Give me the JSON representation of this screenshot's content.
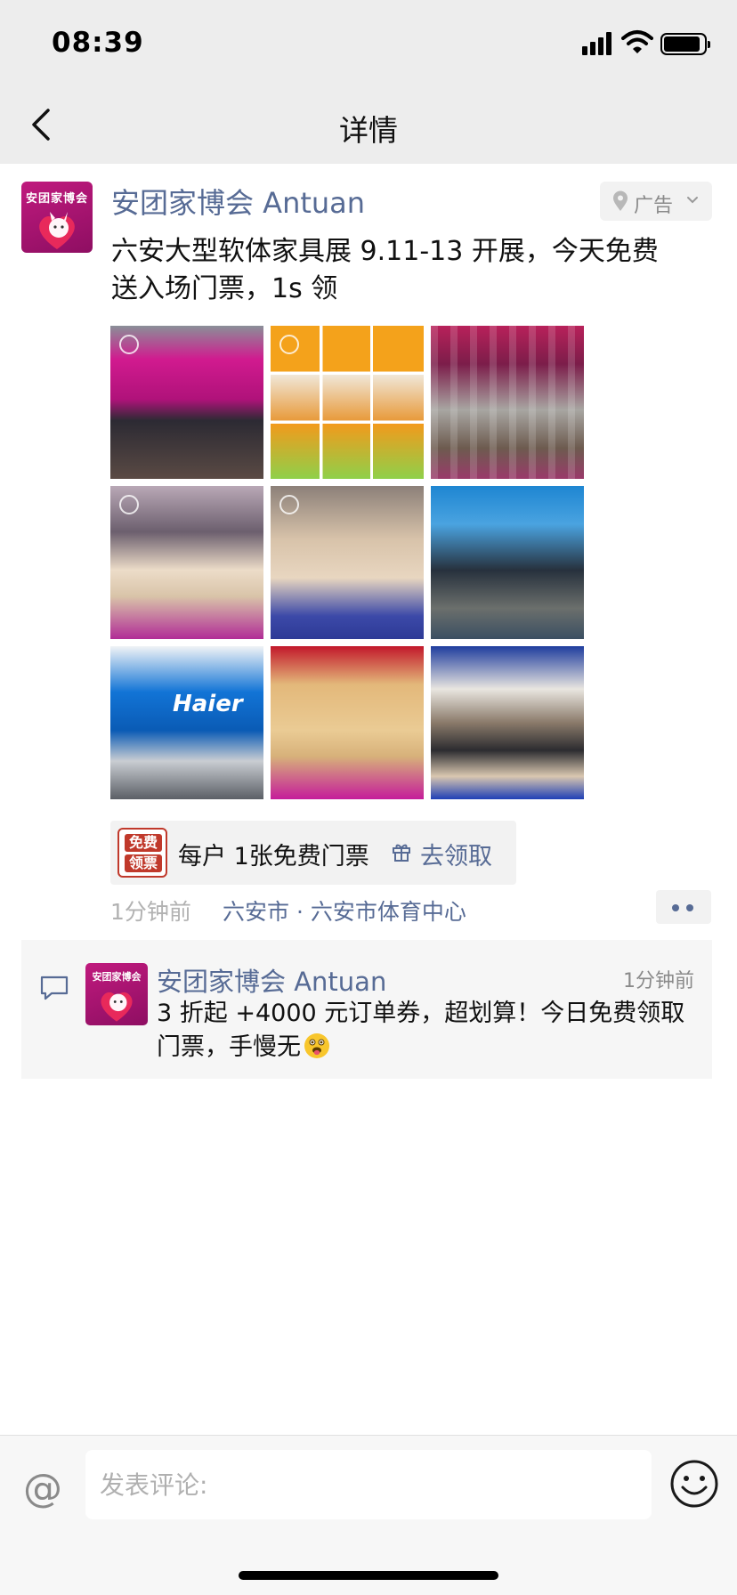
{
  "status_bar": {
    "time": "08:39"
  },
  "nav": {
    "title": "详情"
  },
  "post": {
    "sender": "安团家博会 Antuan",
    "avatar_text": "安团家博会",
    "ad_label": "广告",
    "content": "六安大型软体家具展 9.11-13 开展，今天免费送入场门票，1s 领",
    "images": [
      {
        "name": "pink-exhibition-booth"
      },
      {
        "name": "sofa-collage"
      },
      {
        "name": "exhibition-hall-aerial"
      },
      {
        "name": "beige-sofa-visitors"
      },
      {
        "name": "recliner-demo"
      },
      {
        "name": "blue-exhibition-hall"
      },
      {
        "name": "haier-booth",
        "brand": "Haier"
      },
      {
        "name": "yellow-sofa-booth"
      },
      {
        "name": "leather-sofa-visitors"
      }
    ],
    "ticket": {
      "badge": "免费领票",
      "badge_line1": "免费",
      "badge_line2": "领票",
      "text": "每户 1张免费门票",
      "action": "去领取"
    },
    "time": "1分钟前",
    "location": "六安市 · 六安市体育中心"
  },
  "comment": {
    "author": "安团家博会 Antuan",
    "avatar_text": "安团家博会",
    "time": "1分钟前",
    "text": "3 折起 +4000 元订单券，超划算！今日免费领取门票，手慢无"
  },
  "input": {
    "placeholder": "发表评论:",
    "at_symbol": "@"
  },
  "colors": {
    "link": "#576b95",
    "bar_bg": "#ededed",
    "brand": "#c01a7e"
  }
}
